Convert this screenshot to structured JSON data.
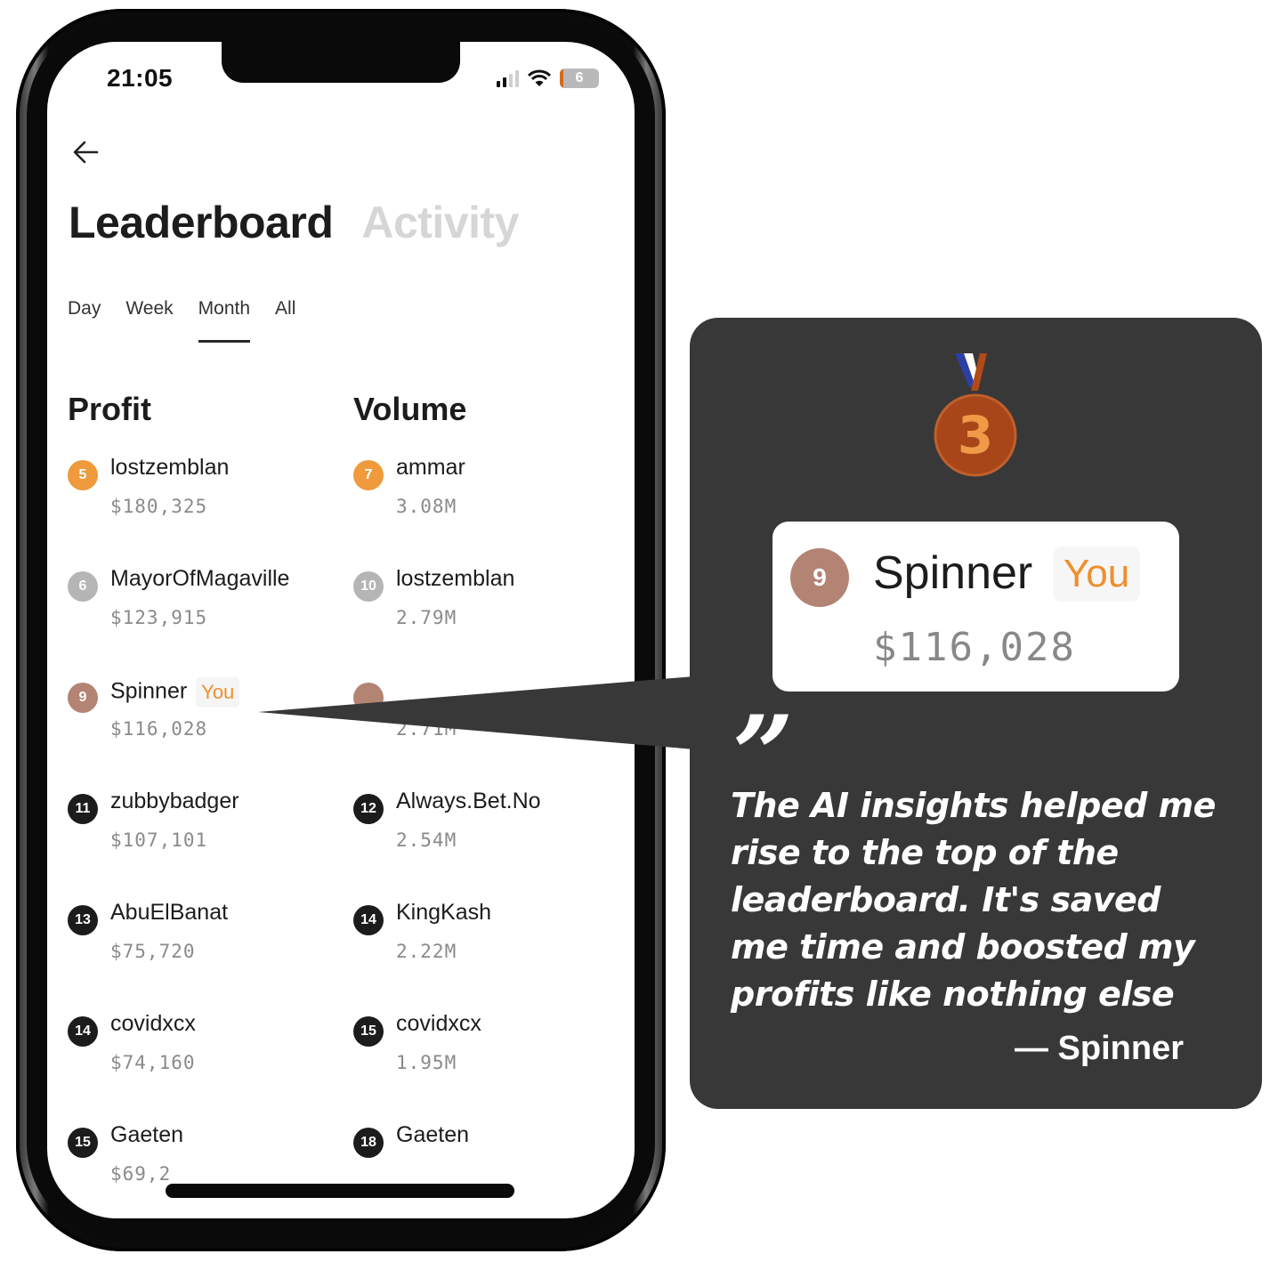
{
  "status_bar": {
    "time": "21:05",
    "battery_level": "6",
    "icons": [
      "signal-icon",
      "wifi-icon",
      "battery-icon"
    ]
  },
  "nav": {
    "back_icon": "arrow-left-icon"
  },
  "header": {
    "title": "Leaderboard",
    "secondary_tab": "Activity"
  },
  "period_tabs": [
    {
      "label": "Day",
      "active": false
    },
    {
      "label": "Week",
      "active": false
    },
    {
      "label": "Month",
      "active": true
    },
    {
      "label": "All",
      "active": false
    }
  ],
  "profit": {
    "heading": "Profit",
    "entries": [
      {
        "rank": "5",
        "name": "lostzemblan",
        "value": "$180,325",
        "badge_color": "#ef9a3c"
      },
      {
        "rank": "6",
        "name": "MayorOfMagaville",
        "value": "$123,915",
        "badge_color": "#b5b5b5"
      },
      {
        "rank": "9",
        "name": "Spinner",
        "value": "$116,028",
        "badge_color": "#b38473",
        "tag": "You"
      },
      {
        "rank": "11",
        "name": "zubbybadger",
        "value": "$107,101",
        "badge_color": "#1c1c1c"
      },
      {
        "rank": "13",
        "name": "AbuElBanat",
        "value": "$75,720",
        "badge_color": "#1c1c1c"
      },
      {
        "rank": "14",
        "name": "covidxcx",
        "value": "$74,160",
        "badge_color": "#1c1c1c"
      },
      {
        "rank": "15",
        "name": "Gaeten",
        "value": "$69,2",
        "badge_color": "#1c1c1c"
      }
    ]
  },
  "volume": {
    "heading": "Volume",
    "entries": [
      {
        "rank": "7",
        "name": "ammar",
        "value": "3.08M",
        "badge_color": "#ef9a3c"
      },
      {
        "rank": "10",
        "name": "lostzemblan",
        "value": "2.79M",
        "badge_color": "#b5b5b5"
      },
      {
        "rank": "",
        "name": "",
        "value": "2.71M",
        "badge_color": "#b38473"
      },
      {
        "rank": "12",
        "name": "Always.Bet.No",
        "value": "2.54M",
        "badge_color": "#1c1c1c"
      },
      {
        "rank": "14",
        "name": "KingKash",
        "value": "2.22M",
        "badge_color": "#1c1c1c"
      },
      {
        "rank": "15",
        "name": "covidxcx",
        "value": "1.95M",
        "badge_color": "#1c1c1c"
      },
      {
        "rank": "18",
        "name": "Gaeten",
        "value": "",
        "badge_color": "#1c1c1c"
      }
    ]
  },
  "testimonial": {
    "medal_icon": "bronze-medal-icon",
    "medal_number": "3",
    "user": {
      "rank": "9",
      "name": "Spinner",
      "tag": "You",
      "value": "$116,028"
    },
    "quote_mark": "”",
    "quote": "The AI insights helped me rise to the top of the leaderboard. It's saved me time and boosted my profits like nothing else",
    "author": "— Spinner"
  },
  "colors": {
    "accent_orange": "#ef8f2c",
    "card_bg": "#383838",
    "rank_gold": "#ef9a3c",
    "rank_silver": "#b5b5b5",
    "rank_bronze": "#b38473"
  }
}
